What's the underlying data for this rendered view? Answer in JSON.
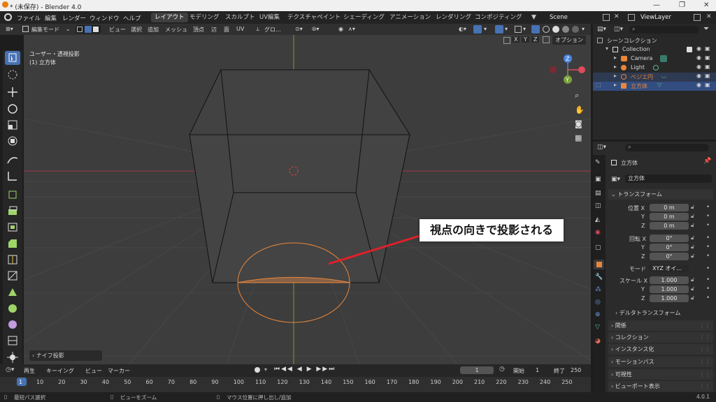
{
  "window": {
    "title": "* (未保存) - Blender 4.0"
  },
  "menubar": {
    "items": [
      "ファイル",
      "編集",
      "レンダー",
      "ウィンドウ",
      "ヘルプ"
    ],
    "workspaces": [
      "レイアウト",
      "モデリング",
      "スカルプト",
      "UV編集",
      "テクスチャペイント",
      "シェーディング",
      "アニメーション",
      "レンダリング",
      "コンポジティング"
    ],
    "active_workspace": "レイアウト",
    "scene": "Scene",
    "view_layer": "ViewLayer"
  },
  "viewport_header": {
    "mode": "編集モード",
    "menus": [
      "ビュー",
      "選択",
      "追加",
      "メッシュ",
      "頂点",
      "辺",
      "面",
      "UV"
    ],
    "transform_orientation": "グロ...",
    "axes": [
      "X",
      "Y",
      "Z"
    ],
    "options": "オプション"
  },
  "viewport": {
    "view_name": "ユーザー・透視投影",
    "object_label": "(1) 立方体",
    "operator_panel": "ナイフ投影",
    "gizmo_z": "Z",
    "gizmo_y": "Y",
    "callout": "視点の向きで投影される",
    "colors": {
      "annotation_arrow": "#e0202a",
      "curve": "#e8863a"
    }
  },
  "outliner": {
    "search_placeholder": "",
    "scene_collection": "シーンコレクション",
    "items": [
      {
        "name": "Collection",
        "indent": 0
      },
      {
        "name": "Camera",
        "indent": 1
      },
      {
        "name": "Light",
        "indent": 1
      },
      {
        "name": "ベジエ円",
        "indent": 1
      },
      {
        "name": "立方体",
        "indent": 1
      }
    ]
  },
  "properties": {
    "object_name": "立方体",
    "object_field": "立方体",
    "transform_title": "トランスフォーム",
    "location_label": "位置 X",
    "location": [
      "0 m",
      "0 m",
      "0 m"
    ],
    "rotation_label": "回転 X",
    "rotation": [
      "0°",
      "0°",
      "0°"
    ],
    "mode_label": "モード",
    "mode_value": "XYZ オイ...",
    "scale_label": "スケール X",
    "scale": [
      "1.000",
      "1.000",
      "1.000"
    ],
    "axis_y": "Y",
    "axis_z": "Z",
    "delta": "デルタトランスフォーム",
    "sections": [
      "関係",
      "コレクション",
      "インスタンス化",
      "モーションパス",
      "可視性",
      "ビューポート表示"
    ]
  },
  "timeline": {
    "menus": [
      "再生",
      "キーイング",
      "ビュー",
      "マーカー"
    ],
    "current_frame": "1",
    "start_label": "開始",
    "start": "1",
    "end_label": "終了",
    "end": "250",
    "ticks": [
      "1",
      "10",
      "20",
      "30",
      "40",
      "50",
      "60",
      "70",
      "80",
      "90",
      "100",
      "110",
      "120",
      "130",
      "140",
      "150",
      "160",
      "170",
      "180",
      "190",
      "200",
      "210",
      "220",
      "230",
      "240",
      "250"
    ]
  },
  "statusbar": {
    "left": "最短パス選択",
    "mid": "ビューをズーム",
    "right": "マウス位置に押し出し/追加",
    "version": "4.0.1"
  }
}
